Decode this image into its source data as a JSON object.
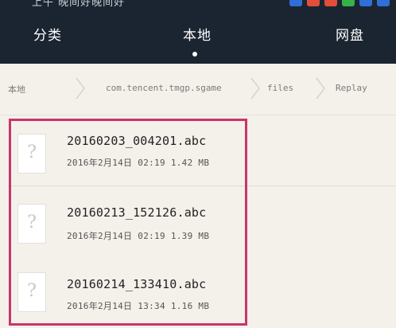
{
  "statusbar": {
    "text": "上午 晚间好晚间好"
  },
  "tabs": [
    {
      "label": "分类"
    },
    {
      "label": "本地"
    },
    {
      "label": "网盘"
    }
  ],
  "active_tab": "本地",
  "breadcrumb": [
    {
      "label": "本地"
    },
    {
      "label": "com.tencent.tmgp.sgame"
    },
    {
      "label": "files"
    },
    {
      "label": "Replay"
    }
  ],
  "files": [
    {
      "name": "20160203_004201.abc",
      "meta": "2016年2月14日 02:19 1.42 MB"
    },
    {
      "name": "20160213_152126.abc",
      "meta": "2016年2月14日 02:19 1.39 MB"
    },
    {
      "name": "20160214_133410.abc",
      "meta": "2016年2月14日 13:34 1.16 MB"
    }
  ],
  "file_icon_glyph": "?",
  "colors": {
    "topbar": "#1b2531",
    "highlight": "#c8356b",
    "background": "#f3f1ea"
  }
}
